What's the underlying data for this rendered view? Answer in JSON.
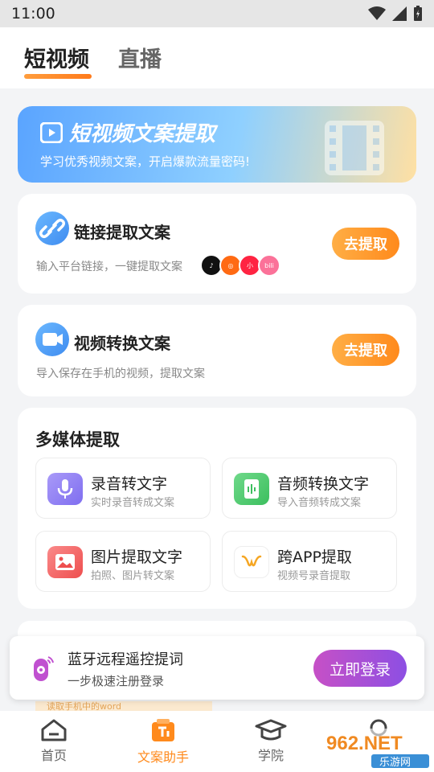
{
  "status": {
    "time": "11:00"
  },
  "tabs": [
    {
      "label": "短视频"
    },
    {
      "label": "直播"
    }
  ],
  "banner": {
    "title": "短视频文案提取",
    "subtitle": "学习优秀视频文案，开启爆款流量密码!"
  },
  "cards": {
    "link": {
      "title": "链接提取文案",
      "desc": "输入平台链接，一键提取文案",
      "button": "去提取",
      "platforms": [
        "tiktok",
        "kuaishou",
        "小红书",
        "bilibili"
      ]
    },
    "video": {
      "title": "视频转换文案",
      "desc": "导入保存在手机的视频，提取文案",
      "button": "去提取"
    }
  },
  "multimedia": {
    "title": "多媒体提取",
    "items": [
      {
        "title": "录音转文字",
        "sub": "实时录音转成文案",
        "icon": "microphone-icon",
        "color": "#9b8cf5"
      },
      {
        "title": "音频转换文字",
        "sub": "导入音频转成文案",
        "icon": "audio-file-icon",
        "color": "#55c96f"
      },
      {
        "title": "图片提取文字",
        "sub": "拍照、图片转文案",
        "icon": "image-icon",
        "color": "#f56a6a"
      },
      {
        "title": "跨APP提取",
        "sub": "视频号录音提取",
        "icon": "wechat-channels-icon",
        "color": "#f5a623"
      }
    ]
  },
  "peek_text": "读取手机中的word",
  "login": {
    "title": "蓝牙远程遥控提词",
    "sub": "一步极速注册登录",
    "button": "立即登录"
  },
  "nav": [
    {
      "label": "首页"
    },
    {
      "label": "文案助手"
    },
    {
      "label": "学院"
    }
  ],
  "watermark": {
    "text": "962.NET",
    "sub": "乐游网"
  }
}
